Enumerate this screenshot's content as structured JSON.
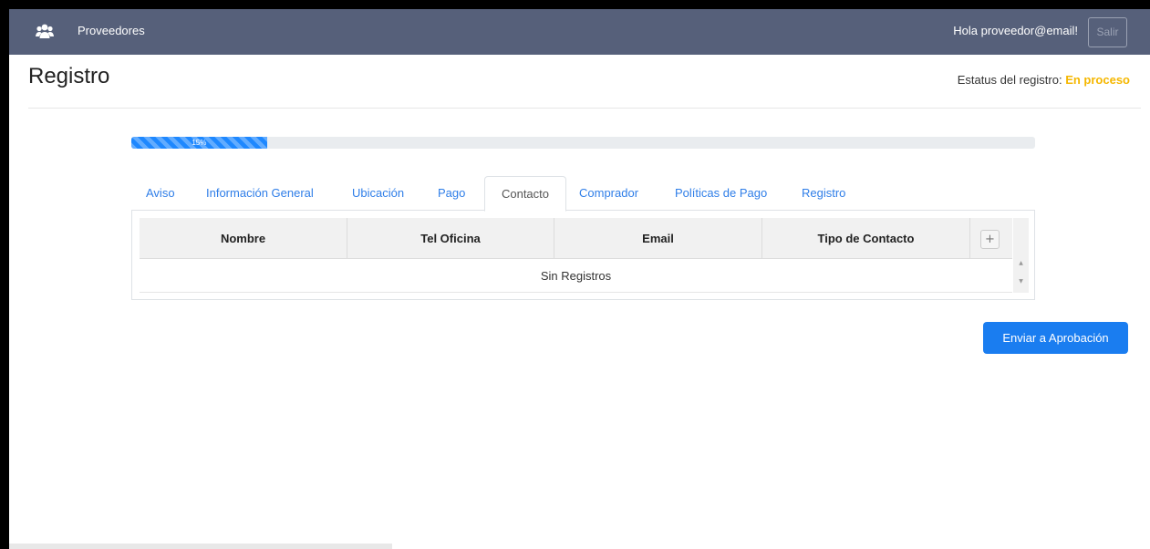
{
  "navbar": {
    "brand": "Proveedores",
    "icon": "users-icon",
    "greeting": "Hola proveedor@email!",
    "logout_label": "Salir"
  },
  "page": {
    "title": "Registro",
    "status_label": "Estatus del registro:",
    "status_value": "En proceso",
    "status_color": "#f5b700"
  },
  "progress": {
    "percent": 15,
    "label": "15%"
  },
  "tabs": [
    {
      "label": "Aviso"
    },
    {
      "label": "Información General"
    },
    {
      "label": "Ubicación"
    },
    {
      "label": "Pago"
    },
    {
      "label": "Contacto",
      "active": true
    },
    {
      "label": "Comprador"
    },
    {
      "label": "Políticas de Pago"
    },
    {
      "label": "Registro"
    }
  ],
  "table": {
    "columns": [
      "Nombre",
      "Tel Oficina",
      "Email",
      "Tipo de Contacto"
    ],
    "add_label": "+",
    "empty_text": "Sin Registros"
  },
  "actions": {
    "approve_label": "Enviar a Aprobación",
    "accent": "#1a7df0"
  }
}
